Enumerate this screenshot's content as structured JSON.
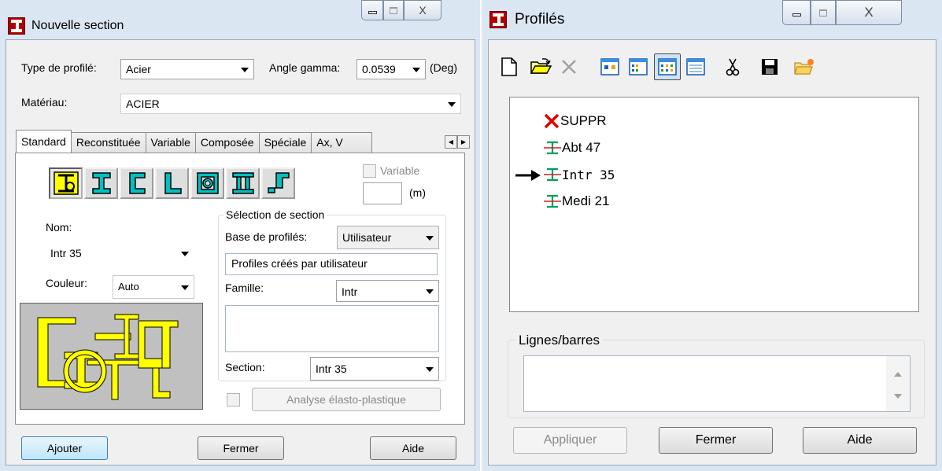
{
  "left_window": {
    "title": "Nouvelle section",
    "close_glyph": "X",
    "type_profile": {
      "label": "Type de profilé:",
      "value": "Acier"
    },
    "angle_gamma": {
      "label": "Angle gamma:",
      "value": "0.0539",
      "unit": "(Deg)"
    },
    "material": {
      "label": "Matériau:",
      "value": "ACIER"
    },
    "tabs": [
      {
        "label": "Standard",
        "active": true
      },
      {
        "label": "Reconstituée"
      },
      {
        "label": "Variable"
      },
      {
        "label": "Composée"
      },
      {
        "label": "Spéciale"
      },
      {
        "label": "Ax, V"
      }
    ],
    "shape_buttons": [
      {
        "name": "compound-section-icon",
        "pressed": true
      },
      {
        "name": "i-section-icon"
      },
      {
        "name": "c-section-icon"
      },
      {
        "name": "l-section-icon"
      },
      {
        "name": "tube-section-icon"
      },
      {
        "name": "double-i-section-icon"
      },
      {
        "name": "t-section-icon"
      }
    ],
    "variable": {
      "label": "Variable",
      "checked": false,
      "unit": "(m)",
      "value": ""
    },
    "nom": {
      "label": "Nom:",
      "value": "Intr 35"
    },
    "couleur": {
      "label": "Couleur:",
      "value": "Auto"
    },
    "selection": {
      "legend": "Sélection de section",
      "base_label": "Base de profilés:",
      "base_value": "Utilisateur",
      "base_description": "Profiles créés par utilisateur",
      "famille_label": "Famille:",
      "famille_value": "Intr",
      "section_label": "Section:",
      "section_value": "Intr 35"
    },
    "analyse": {
      "label": "Analyse élasto-plastique",
      "enabled": false
    },
    "buttons": {
      "add": "Ajouter",
      "close": "Fermer",
      "help": "Aide"
    }
  },
  "right_window": {
    "title": "Profilés",
    "close_glyph": "X",
    "toolbar": [
      {
        "name": "new-icon"
      },
      {
        "name": "open-folder-icon"
      },
      {
        "name": "delete-icon",
        "enabled": false
      },
      {
        "name": "view-large-icons-icon"
      },
      {
        "name": "view-small-icons-icon"
      },
      {
        "name": "view-list-icon",
        "pressed": true
      },
      {
        "name": "view-details-icon"
      },
      {
        "name": "cut-icon"
      },
      {
        "name": "save-icon"
      },
      {
        "name": "new-folder-icon"
      }
    ],
    "tree": [
      {
        "label": "SUPPR",
        "icon": "delete-marker-icon"
      },
      {
        "label": "Abt 47",
        "icon": "profile-icon"
      },
      {
        "label": "Intr 35",
        "icon": "profile-icon",
        "current": true
      },
      {
        "label": "Medi 21",
        "icon": "profile-icon"
      }
    ],
    "lines_label": "Lignes/barres",
    "lines_value": "",
    "buttons": {
      "apply": "Appliquer",
      "close": "Fermer",
      "help": "Aide"
    }
  },
  "colors": {
    "frame": "#dbe6f3",
    "client": "#f0f0f0",
    "shape_teal": "#00c0c0",
    "preview_yellow": "#ffff00",
    "app_icon_red": "#b00000"
  }
}
